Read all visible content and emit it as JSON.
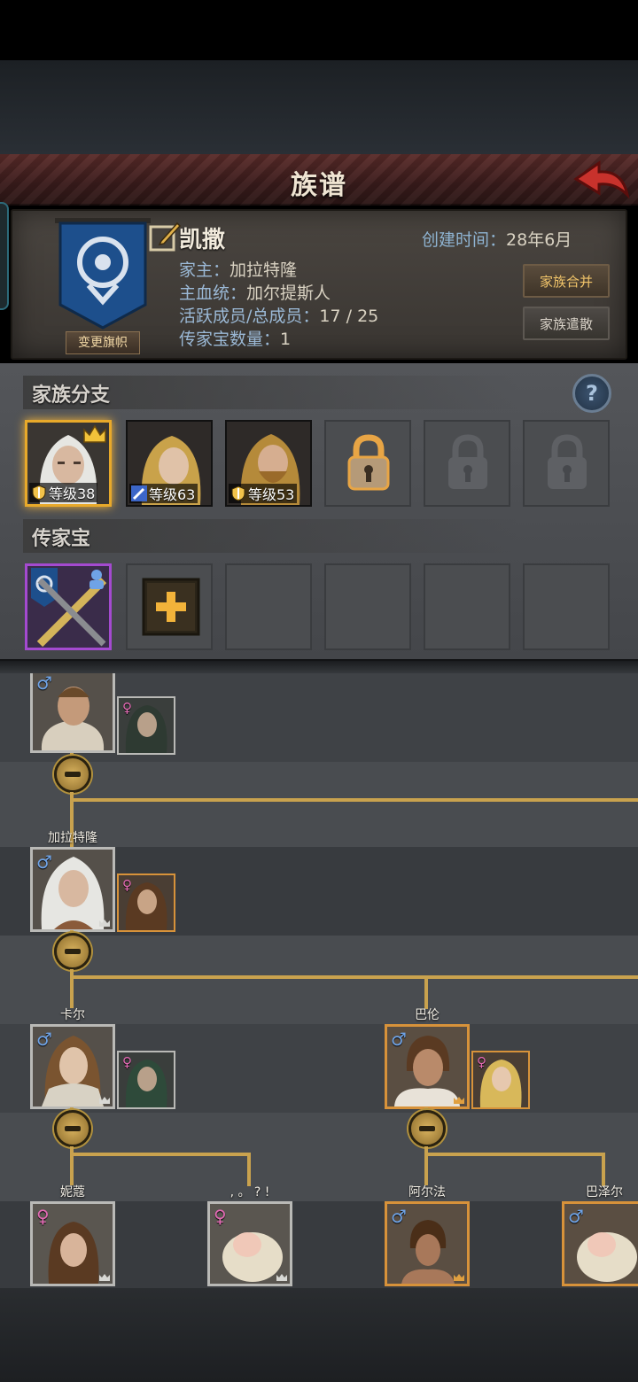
{
  "header": {
    "title": "族谱"
  },
  "family": {
    "name": "凯撒",
    "created_label": "创建时间：",
    "created_value": "28年6月",
    "head_label": "家主：",
    "head_value": "加拉特隆",
    "bloodline_label": "主血统：",
    "bloodline_value": "加尔提斯人",
    "members_label": "活跃成员/总成员：",
    "members_value": "17 / 25",
    "heirloom_label": "传家宝数量：",
    "heirloom_value": "1",
    "change_banner": "变更旗帜",
    "merge_button": "家族合并",
    "disband_button": "家族遣散"
  },
  "branches": {
    "title": "家族分支",
    "help": "?",
    "items": [
      {
        "level": "等级38",
        "role": "shield-icon"
      },
      {
        "level": "等级63",
        "role": "sword-icon"
      },
      {
        "level": "等级53",
        "role": "shield-icon"
      }
    ]
  },
  "heirlooms": {
    "title": "传家宝"
  },
  "tree": {
    "gen2_name": "加拉特隆",
    "gen3": [
      {
        "name": "卡尔"
      },
      {
        "name": "巴伦"
      }
    ],
    "gen4": [
      {
        "name": "妮蔻"
      },
      {
        "name": ", 。 ? !"
      },
      {
        "name": "阿尔法"
      },
      {
        "name": "巴泽尔"
      }
    ]
  },
  "colors": {
    "gold": "#c9a24e",
    "male": "#6fa3e6",
    "female": "#e36ab4",
    "title_bar": "#5b2c2a"
  }
}
